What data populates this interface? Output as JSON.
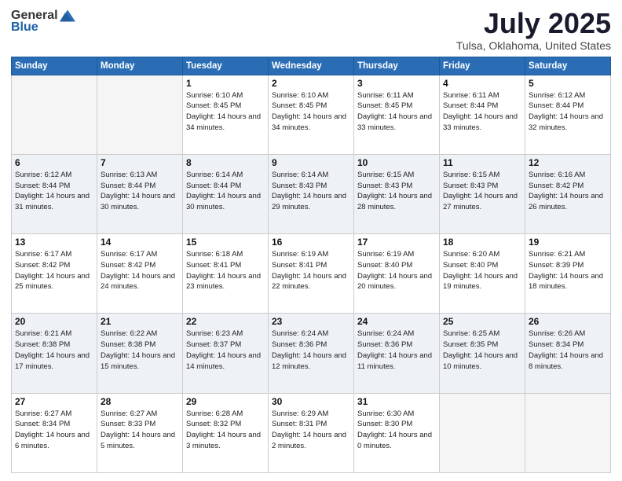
{
  "logo": {
    "general": "General",
    "blue": "Blue"
  },
  "header": {
    "month": "July 2025",
    "location": "Tulsa, Oklahoma, United States"
  },
  "weekdays": [
    "Sunday",
    "Monday",
    "Tuesday",
    "Wednesday",
    "Thursday",
    "Friday",
    "Saturday"
  ],
  "weeks": [
    [
      {
        "day": "",
        "sunrise": "",
        "sunset": "",
        "daylight": ""
      },
      {
        "day": "",
        "sunrise": "",
        "sunset": "",
        "daylight": ""
      },
      {
        "day": "1",
        "sunrise": "Sunrise: 6:10 AM",
        "sunset": "Sunset: 8:45 PM",
        "daylight": "Daylight: 14 hours and 34 minutes."
      },
      {
        "day": "2",
        "sunrise": "Sunrise: 6:10 AM",
        "sunset": "Sunset: 8:45 PM",
        "daylight": "Daylight: 14 hours and 34 minutes."
      },
      {
        "day": "3",
        "sunrise": "Sunrise: 6:11 AM",
        "sunset": "Sunset: 8:45 PM",
        "daylight": "Daylight: 14 hours and 33 minutes."
      },
      {
        "day": "4",
        "sunrise": "Sunrise: 6:11 AM",
        "sunset": "Sunset: 8:44 PM",
        "daylight": "Daylight: 14 hours and 33 minutes."
      },
      {
        "day": "5",
        "sunrise": "Sunrise: 6:12 AM",
        "sunset": "Sunset: 8:44 PM",
        "daylight": "Daylight: 14 hours and 32 minutes."
      }
    ],
    [
      {
        "day": "6",
        "sunrise": "Sunrise: 6:12 AM",
        "sunset": "Sunset: 8:44 PM",
        "daylight": "Daylight: 14 hours and 31 minutes."
      },
      {
        "day": "7",
        "sunrise": "Sunrise: 6:13 AM",
        "sunset": "Sunset: 8:44 PM",
        "daylight": "Daylight: 14 hours and 30 minutes."
      },
      {
        "day": "8",
        "sunrise": "Sunrise: 6:14 AM",
        "sunset": "Sunset: 8:44 PM",
        "daylight": "Daylight: 14 hours and 30 minutes."
      },
      {
        "day": "9",
        "sunrise": "Sunrise: 6:14 AM",
        "sunset": "Sunset: 8:43 PM",
        "daylight": "Daylight: 14 hours and 29 minutes."
      },
      {
        "day": "10",
        "sunrise": "Sunrise: 6:15 AM",
        "sunset": "Sunset: 8:43 PM",
        "daylight": "Daylight: 14 hours and 28 minutes."
      },
      {
        "day": "11",
        "sunrise": "Sunrise: 6:15 AM",
        "sunset": "Sunset: 8:43 PM",
        "daylight": "Daylight: 14 hours and 27 minutes."
      },
      {
        "day": "12",
        "sunrise": "Sunrise: 6:16 AM",
        "sunset": "Sunset: 8:42 PM",
        "daylight": "Daylight: 14 hours and 26 minutes."
      }
    ],
    [
      {
        "day": "13",
        "sunrise": "Sunrise: 6:17 AM",
        "sunset": "Sunset: 8:42 PM",
        "daylight": "Daylight: 14 hours and 25 minutes."
      },
      {
        "day": "14",
        "sunrise": "Sunrise: 6:17 AM",
        "sunset": "Sunset: 8:42 PM",
        "daylight": "Daylight: 14 hours and 24 minutes."
      },
      {
        "day": "15",
        "sunrise": "Sunrise: 6:18 AM",
        "sunset": "Sunset: 8:41 PM",
        "daylight": "Daylight: 14 hours and 23 minutes."
      },
      {
        "day": "16",
        "sunrise": "Sunrise: 6:19 AM",
        "sunset": "Sunset: 8:41 PM",
        "daylight": "Daylight: 14 hours and 22 minutes."
      },
      {
        "day": "17",
        "sunrise": "Sunrise: 6:19 AM",
        "sunset": "Sunset: 8:40 PM",
        "daylight": "Daylight: 14 hours and 20 minutes."
      },
      {
        "day": "18",
        "sunrise": "Sunrise: 6:20 AM",
        "sunset": "Sunset: 8:40 PM",
        "daylight": "Daylight: 14 hours and 19 minutes."
      },
      {
        "day": "19",
        "sunrise": "Sunrise: 6:21 AM",
        "sunset": "Sunset: 8:39 PM",
        "daylight": "Daylight: 14 hours and 18 minutes."
      }
    ],
    [
      {
        "day": "20",
        "sunrise": "Sunrise: 6:21 AM",
        "sunset": "Sunset: 8:38 PM",
        "daylight": "Daylight: 14 hours and 17 minutes."
      },
      {
        "day": "21",
        "sunrise": "Sunrise: 6:22 AM",
        "sunset": "Sunset: 8:38 PM",
        "daylight": "Daylight: 14 hours and 15 minutes."
      },
      {
        "day": "22",
        "sunrise": "Sunrise: 6:23 AM",
        "sunset": "Sunset: 8:37 PM",
        "daylight": "Daylight: 14 hours and 14 minutes."
      },
      {
        "day": "23",
        "sunrise": "Sunrise: 6:24 AM",
        "sunset": "Sunset: 8:36 PM",
        "daylight": "Daylight: 14 hours and 12 minutes."
      },
      {
        "day": "24",
        "sunrise": "Sunrise: 6:24 AM",
        "sunset": "Sunset: 8:36 PM",
        "daylight": "Daylight: 14 hours and 11 minutes."
      },
      {
        "day": "25",
        "sunrise": "Sunrise: 6:25 AM",
        "sunset": "Sunset: 8:35 PM",
        "daylight": "Daylight: 14 hours and 10 minutes."
      },
      {
        "day": "26",
        "sunrise": "Sunrise: 6:26 AM",
        "sunset": "Sunset: 8:34 PM",
        "daylight": "Daylight: 14 hours and 8 minutes."
      }
    ],
    [
      {
        "day": "27",
        "sunrise": "Sunrise: 6:27 AM",
        "sunset": "Sunset: 8:34 PM",
        "daylight": "Daylight: 14 hours and 6 minutes."
      },
      {
        "day": "28",
        "sunrise": "Sunrise: 6:27 AM",
        "sunset": "Sunset: 8:33 PM",
        "daylight": "Daylight: 14 hours and 5 minutes."
      },
      {
        "day": "29",
        "sunrise": "Sunrise: 6:28 AM",
        "sunset": "Sunset: 8:32 PM",
        "daylight": "Daylight: 14 hours and 3 minutes."
      },
      {
        "day": "30",
        "sunrise": "Sunrise: 6:29 AM",
        "sunset": "Sunset: 8:31 PM",
        "daylight": "Daylight: 14 hours and 2 minutes."
      },
      {
        "day": "31",
        "sunrise": "Sunrise: 6:30 AM",
        "sunset": "Sunset: 8:30 PM",
        "daylight": "Daylight: 14 hours and 0 minutes."
      },
      {
        "day": "",
        "sunrise": "",
        "sunset": "",
        "daylight": ""
      },
      {
        "day": "",
        "sunrise": "",
        "sunset": "",
        "daylight": ""
      }
    ]
  ]
}
